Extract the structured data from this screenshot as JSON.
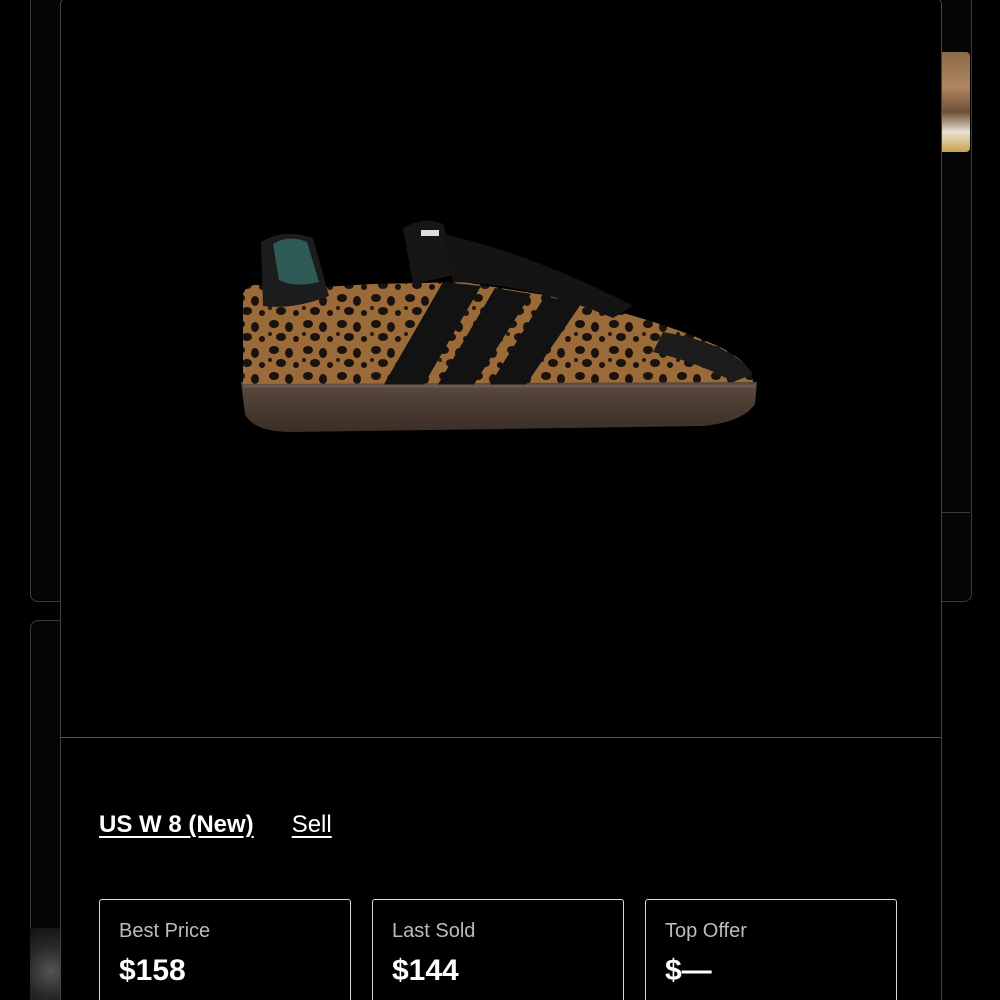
{
  "product": {
    "image_alt": "leopard print sneaker",
    "size_label": "US W 8 (New)",
    "sell_label": "Sell"
  },
  "prices": [
    {
      "label": "Best Price",
      "value": "$158"
    },
    {
      "label": "Last Sold",
      "value": "$144"
    },
    {
      "label": "Top Offer",
      "value": "$—"
    }
  ]
}
